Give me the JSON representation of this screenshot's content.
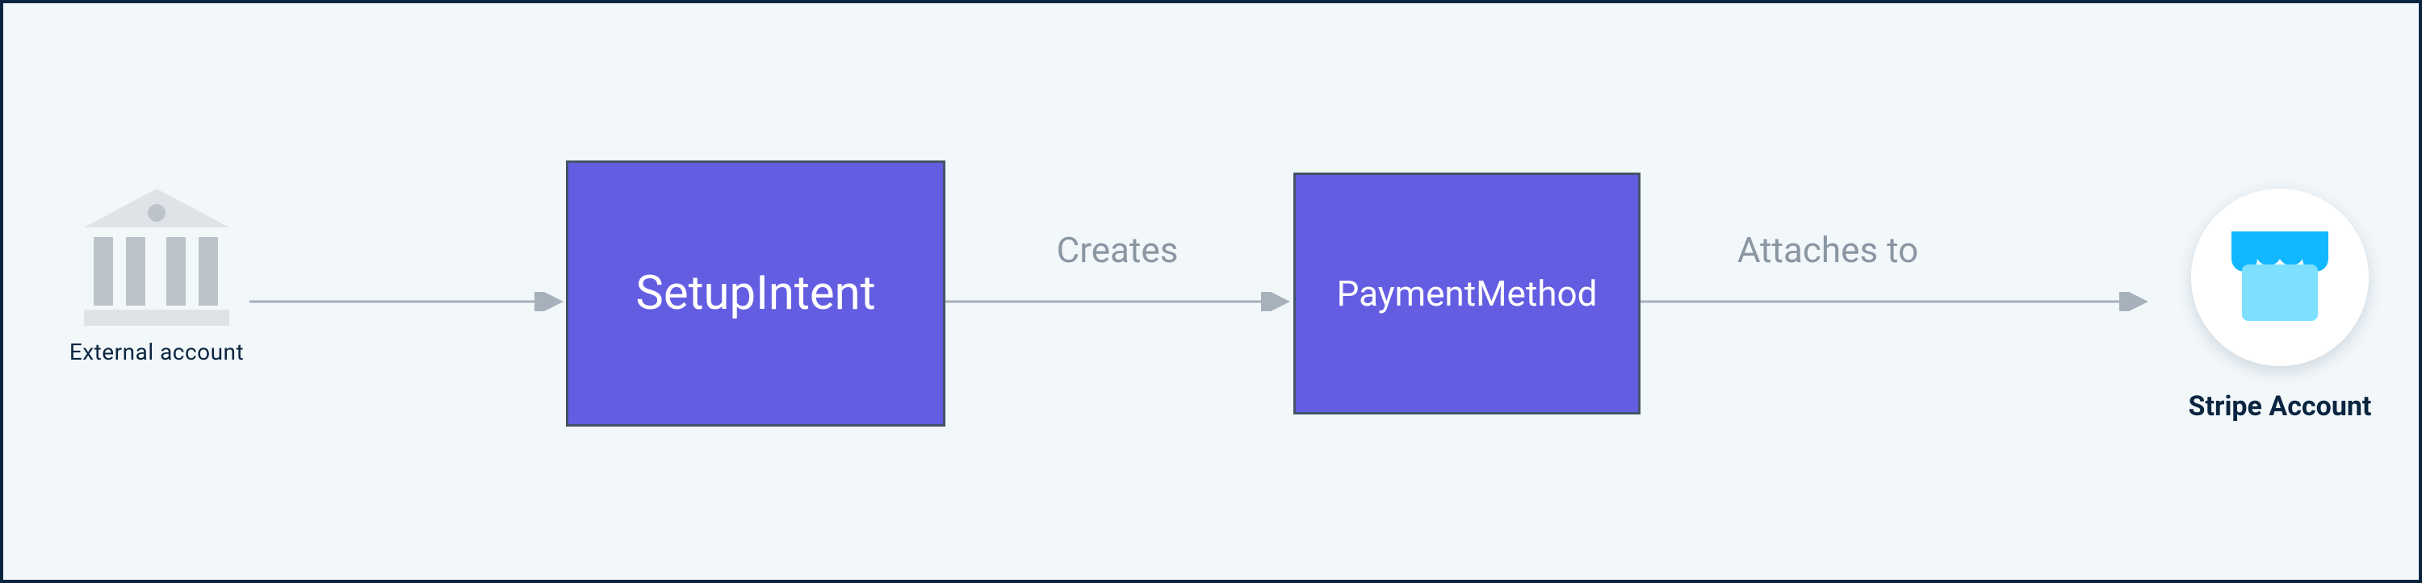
{
  "nodes": {
    "external_account": {
      "label": "External account"
    },
    "setup_intent": {
      "label": "SetupIntent"
    },
    "payment_method": {
      "label": "PaymentMethod"
    },
    "stripe_account": {
      "label": "Stripe Account"
    }
  },
  "edges": {
    "ext_to_setup": {
      "label": ""
    },
    "setup_to_pm": {
      "label": "Creates"
    },
    "pm_to_stripe": {
      "label": "Attaches to"
    }
  },
  "colors": {
    "box": "#635de2",
    "box_border": "#425466",
    "arrow": "#a6b1bb",
    "edge_label": "#8a97a3",
    "frame_border": "#0a2540",
    "bg": "#f2f7fa"
  }
}
